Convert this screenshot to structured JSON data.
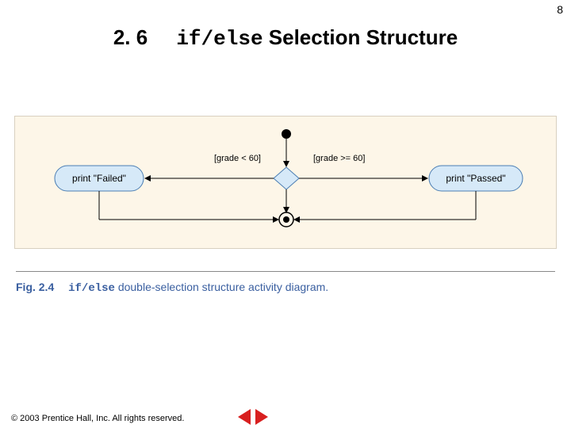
{
  "page_number": "8",
  "title": {
    "section": "2. 6",
    "code": "if/else",
    "rest": " Selection Structure"
  },
  "diagram": {
    "guard_left": "[grade < 60]",
    "guard_right": "[grade >= 60]",
    "action_left": "print \"Failed\"",
    "action_right": "print \"Passed\""
  },
  "caption": {
    "fig_label": "Fig. 2.4",
    "code": "if/else",
    "rest": " double-selection structure activity diagram."
  },
  "footer": {
    "copyright": "© 2003 Prentice Hall, Inc.  All rights reserved."
  },
  "icons": {
    "prev": "prev-slide",
    "next": "next-slide"
  }
}
